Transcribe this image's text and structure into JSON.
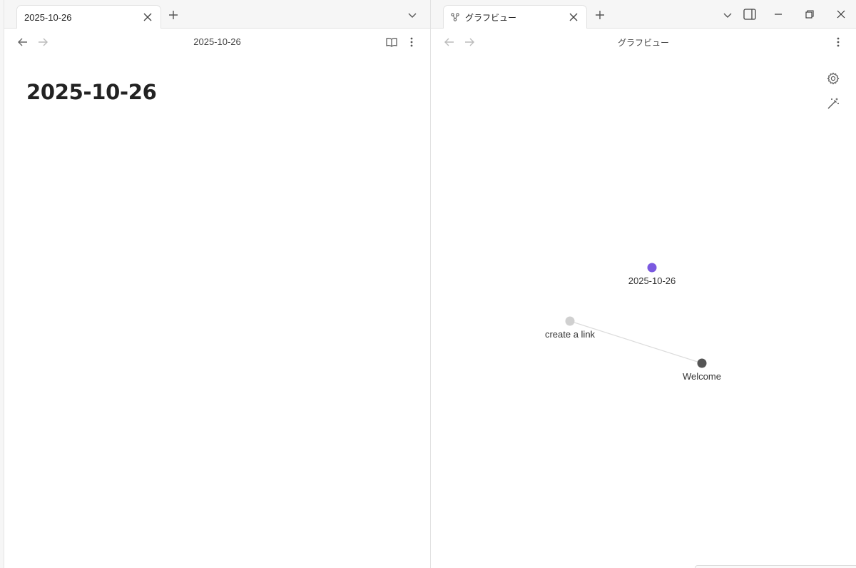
{
  "left_pane": {
    "tab": {
      "label": "2025-10-26"
    },
    "nav_title": "2025-10-26",
    "note_title": "2025-10-26"
  },
  "right_pane": {
    "tab": {
      "label": "グラフビュー",
      "icon": "graph-icon"
    },
    "nav_title": "グラフビュー"
  },
  "graph": {
    "nodes": [
      {
        "id": "n1",
        "label": "2025-10-26",
        "color": "#7b5ae0"
      },
      {
        "id": "n2",
        "label": "create a link",
        "color": "#d0d0d0"
      },
      {
        "id": "n3",
        "label": "Welcome",
        "color": "#555555"
      }
    ],
    "links": [
      {
        "from": "n2",
        "to": "n3"
      }
    ]
  },
  "icons": [
    "close-icon",
    "plus-icon",
    "chevron-down-icon",
    "arrow-left-icon",
    "arrow-right-icon",
    "book-icon",
    "more-vertical-icon",
    "sidebar-toggle-icon",
    "minimize-icon",
    "restore-icon",
    "window-close-icon",
    "gear-icon",
    "wand-icon"
  ]
}
